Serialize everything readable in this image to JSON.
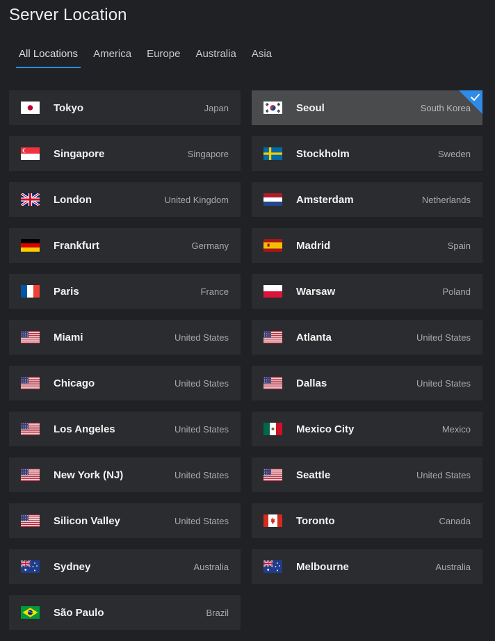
{
  "page": {
    "title": "Server Location"
  },
  "tabs": [
    {
      "label": "All Locations",
      "active": true
    },
    {
      "label": "America",
      "active": false
    },
    {
      "label": "Europe",
      "active": false
    },
    {
      "label": "Australia",
      "active": false
    },
    {
      "label": "Asia",
      "active": false
    }
  ],
  "accent_color": "#2f8be8",
  "locations": [
    {
      "city": "Tokyo",
      "country": "Japan",
      "flag": "jp"
    },
    {
      "city": "Seoul",
      "country": "South Korea",
      "flag": "kr",
      "selected": true
    },
    {
      "city": "Singapore",
      "country": "Singapore",
      "flag": "sg"
    },
    {
      "city": "Stockholm",
      "country": "Sweden",
      "flag": "se"
    },
    {
      "city": "London",
      "country": "United Kingdom",
      "flag": "gb"
    },
    {
      "city": "Amsterdam",
      "country": "Netherlands",
      "flag": "nl"
    },
    {
      "city": "Frankfurt",
      "country": "Germany",
      "flag": "de"
    },
    {
      "city": "Madrid",
      "country": "Spain",
      "flag": "es"
    },
    {
      "city": "Paris",
      "country": "France",
      "flag": "fr"
    },
    {
      "city": "Warsaw",
      "country": "Poland",
      "flag": "pl"
    },
    {
      "city": "Miami",
      "country": "United States",
      "flag": "us"
    },
    {
      "city": "Atlanta",
      "country": "United States",
      "flag": "us"
    },
    {
      "city": "Chicago",
      "country": "United States",
      "flag": "us"
    },
    {
      "city": "Dallas",
      "country": "United States",
      "flag": "us"
    },
    {
      "city": "Los Angeles",
      "country": "United States",
      "flag": "us"
    },
    {
      "city": "Mexico City",
      "country": "Mexico",
      "flag": "mx"
    },
    {
      "city": "New York (NJ)",
      "country": "United States",
      "flag": "us"
    },
    {
      "city": "Seattle",
      "country": "United States",
      "flag": "us"
    },
    {
      "city": "Silicon Valley",
      "country": "United States",
      "flag": "us"
    },
    {
      "city": "Toronto",
      "country": "Canada",
      "flag": "ca"
    },
    {
      "city": "Sydney",
      "country": "Australia",
      "flag": "au"
    },
    {
      "city": "Melbourne",
      "country": "Australia",
      "flag": "au"
    },
    {
      "city": "São Paulo",
      "country": "Brazil",
      "flag": "br"
    }
  ]
}
